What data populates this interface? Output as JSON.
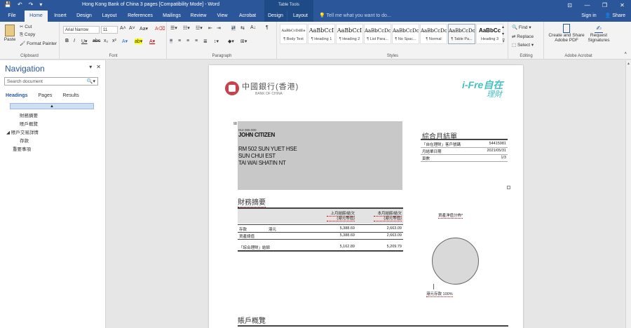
{
  "titlebar": {
    "title": "Hong Kong Bank of China 3 pages [Compatibility Mode] - Word",
    "context_group": "Table Tools",
    "qat": [
      "💾",
      "↶",
      "↷",
      "▾"
    ],
    "window_controls": [
      "⊡",
      "—",
      "❐",
      "✕"
    ]
  },
  "tabs": {
    "items": [
      {
        "label": "File"
      },
      {
        "label": "Home"
      },
      {
        "label": "Insert"
      },
      {
        "label": "Design"
      },
      {
        "label": "Layout"
      },
      {
        "label": "References"
      },
      {
        "label": "Mailings"
      },
      {
        "label": "Review"
      },
      {
        "label": "View"
      },
      {
        "label": "Acrobat"
      },
      {
        "label": "Design"
      },
      {
        "label": "Layout"
      }
    ],
    "tell_me": "Tell me what you want to do...",
    "sign_in": "Sign in",
    "share": "Share"
  },
  "ribbon": {
    "clipboard": {
      "paste": "Paste",
      "cut": "Cut",
      "copy": "Copy",
      "format_painter": "Format Painter",
      "label": "Clipboard"
    },
    "font": {
      "name": "Arial Narrow",
      "size": "11",
      "label": "Font"
    },
    "paragraph": {
      "label": "Paragraph"
    },
    "styles": {
      "label": "Styles",
      "items": [
        {
          "preview": "AaBbCcDdEe",
          "name": "¶ Body Text"
        },
        {
          "preview": "AaBbCcI",
          "name": "¶ Heading 1"
        },
        {
          "preview": "AaBbCcI",
          "name": "¶ Heading 2"
        },
        {
          "preview": "AaBbCcDc",
          "name": "¶ List Para..."
        },
        {
          "preview": "AaBbCcDc",
          "name": "¶ No Spac..."
        },
        {
          "preview": "AaBbCcDc",
          "name": "¶ Normal"
        },
        {
          "preview": "AaBbCcDc",
          "name": "¶ Table Pa..."
        },
        {
          "preview": "AaBbCc",
          "name": "Heading 3"
        }
      ]
    },
    "editing": {
      "find": "Find",
      "replace": "Replace",
      "select": "Select",
      "label": "Editing"
    },
    "acrobat": {
      "create_share": "Create and Share",
      "adobe_pdf": "Adobe PDF",
      "request": "Request",
      "signatures": "Signatures",
      "label": "Adobe Acrobat"
    }
  },
  "nav": {
    "title": "Navigation",
    "search_placeholder": "Search document",
    "tabs": [
      "Headings",
      "Pages",
      "Results"
    ],
    "tree": [
      {
        "label": "財務摘要"
      },
      {
        "label": "賬戶概覽"
      },
      {
        "label": "賬戶交易詳情"
      },
      {
        "label": "存款"
      },
      {
        "label": "重要事項"
      }
    ]
  },
  "document": {
    "logo_zh": "中國銀行(香港)",
    "logo_en": "BANK OF CHINA",
    "ifre_1": "i-Fre自在",
    "ifre_2": "理財",
    "address": {
      "code": "012-365-000",
      "name": "JOHN CITIZEN",
      "line1": "RM 502 SUN YUET HSE",
      "line2": "SUN CHUI EST",
      "line3": "TAI WAI SHATIN NT"
    },
    "summary": {
      "title": "綜合月結單",
      "rows": [
        {
          "label": "「自在理財」客戶號碼",
          "value": "54415981"
        },
        {
          "label": "月結單日期",
          "value": "2021/05/31"
        },
        {
          "label": "頁數",
          "value": "1/3"
        }
      ]
    },
    "financial": {
      "title": "財務摘要",
      "col1": "上月結餘/結欠",
      "col1b": "(港元等值)",
      "col2": "本月結餘/結欠",
      "col2b": "(港元等值)",
      "rows": [
        {
          "label": "存款",
          "sub": "港元",
          "v1": "5,388.69",
          "v2": "2,663.09"
        },
        {
          "label": "資產總值",
          "sub": "",
          "v1": "5,388.69",
          "v2": "2,663.09"
        },
        {
          "label": "「綜合理財」結餘",
          "sub": "",
          "v1": "5,162.89",
          "v2": "5,209.79"
        }
      ]
    },
    "pie": {
      "title": "資產淨值分佈*",
      "label": "港元存款 100%",
      "value_pct": 100
    },
    "overview_title": "賬戶概覽"
  }
}
